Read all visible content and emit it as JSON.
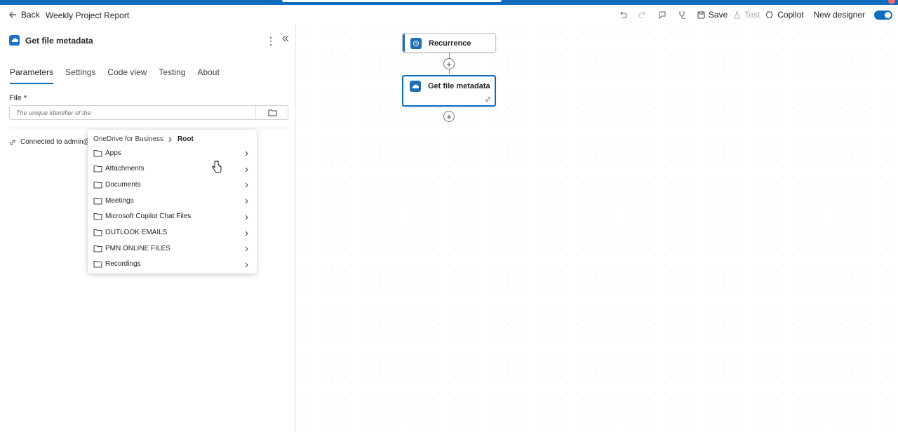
{
  "header": {
    "back_label": "Back",
    "flow_name": "Weekly Project Report",
    "save_label": "Save",
    "test_label": "Test",
    "copilot_label": "Copilot",
    "new_designer_label": "New designer",
    "new_designer_enabled": true
  },
  "panel": {
    "title": "Get file metadata",
    "tabs": [
      {
        "label": "Parameters",
        "active": true
      },
      {
        "label": "Settings",
        "active": false
      },
      {
        "label": "Code view",
        "active": false
      },
      {
        "label": "Testing",
        "active": false
      },
      {
        "label": "About",
        "active": false
      }
    ],
    "file_label": "File *",
    "file_placeholder": "The unique identifier of the",
    "connected_text": "Connected to admin@p"
  },
  "picker": {
    "crumb_root": "OneDrive for Business",
    "crumb_current": "Root",
    "folders": [
      "Apps",
      "Attachments",
      "Documents",
      "Meetings",
      "Microsoft Copilot Chat Files",
      "OUTLOOK EMAILS",
      "PMN ONLINE FILES",
      "Recordings"
    ]
  },
  "canvas": {
    "nodes": [
      {
        "label": "Recurrence",
        "icon": "clock-icon"
      },
      {
        "label": "Get file metadata",
        "icon": "onedrive-icon"
      }
    ]
  },
  "colors": {
    "accent": "#0f6cbd",
    "node_icon": "#1f6fb6"
  }
}
